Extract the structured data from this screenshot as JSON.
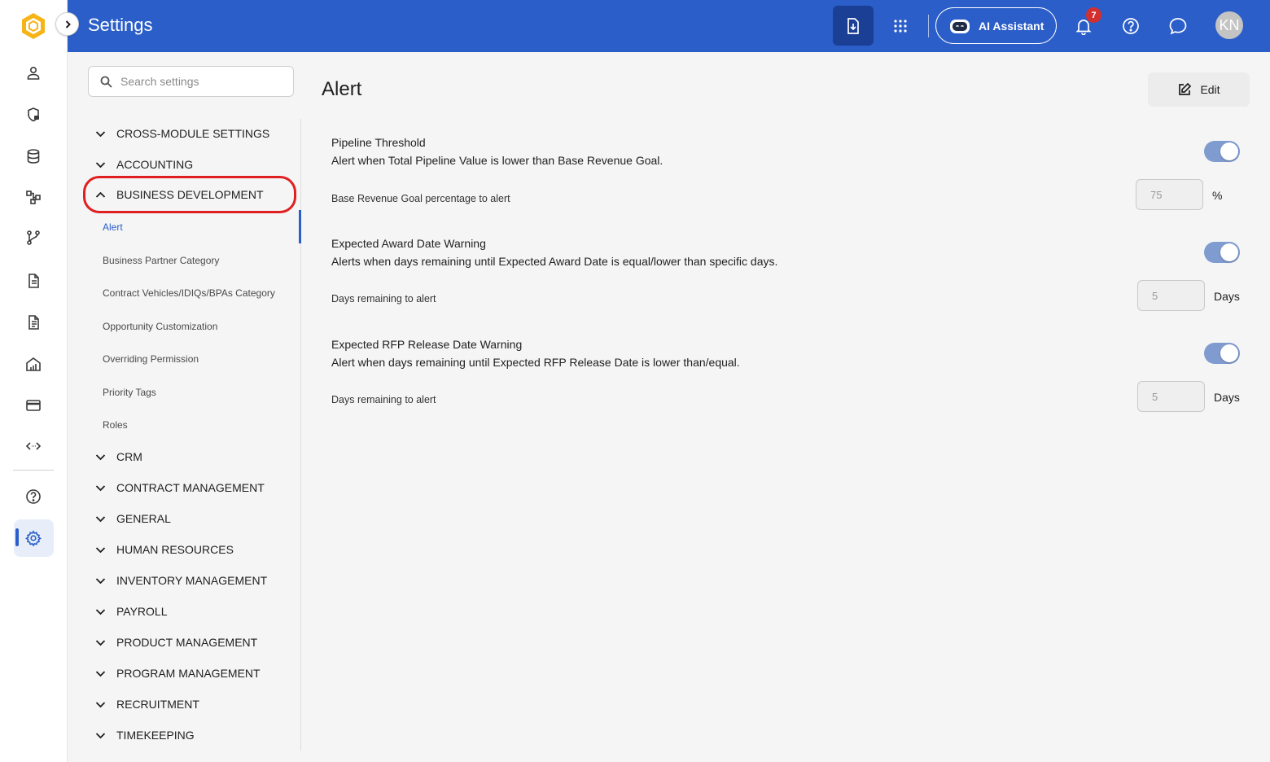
{
  "header": {
    "title": "Settings",
    "ai_assistant_label": "AI Assistant",
    "notification_count": "7",
    "avatar_initials": "KN"
  },
  "search": {
    "placeholder": "Search settings"
  },
  "nav": {
    "sections_top": [
      {
        "label": "CROSS-MODULE SETTINGS",
        "expanded": false
      },
      {
        "label": "ACCOUNTING",
        "expanded": false
      },
      {
        "label": "BUSINESS DEVELOPMENT",
        "expanded": true
      }
    ],
    "sub_items": [
      {
        "label": "Alert",
        "active": true
      },
      {
        "label": "Business Partner Category"
      },
      {
        "label": "Contract Vehicles/IDIQs/BPAs Category"
      },
      {
        "label": "Opportunity Customization"
      },
      {
        "label": "Overriding Permission"
      },
      {
        "label": "Priority Tags"
      },
      {
        "label": "Roles"
      }
    ],
    "sections_bottom": [
      {
        "label": "CRM"
      },
      {
        "label": "CONTRACT MANAGEMENT"
      },
      {
        "label": "GENERAL"
      },
      {
        "label": "HUMAN RESOURCES"
      },
      {
        "label": "INVENTORY MANAGEMENT"
      },
      {
        "label": "PAYROLL"
      },
      {
        "label": "PRODUCT MANAGEMENT"
      },
      {
        "label": "PROGRAM MANAGEMENT"
      },
      {
        "label": "RECRUITMENT"
      },
      {
        "label": "TIMEKEEPING"
      }
    ]
  },
  "content": {
    "title": "Alert",
    "edit_label": "Edit",
    "settings": [
      {
        "title": "Pipeline Threshold",
        "description": "Alert when Total Pipeline Value is lower than Base Revenue Goal.",
        "enabled": true,
        "field_label": "Base Revenue Goal percentage to alert",
        "field_value": "75",
        "unit": "%"
      },
      {
        "title": "Expected Award Date Warning",
        "description": "Alerts when days remaining until Expected Award Date is equal/lower than specific days.",
        "enabled": true,
        "field_label": "Days remaining to alert",
        "field_value": "5",
        "unit": "Days"
      },
      {
        "title": "Expected RFP Release Date Warning",
        "description": "Alert when days remaining until Expected RFP Release Date is lower than/equal.",
        "enabled": true,
        "field_label": "Days remaining to alert",
        "field_value": "5",
        "unit": "Days"
      }
    ]
  },
  "colors": {
    "brand": "#2b5ec9",
    "header_dark": "#1a3f94",
    "toggle_on": "#7f9bd0",
    "badge": "#d32f2f",
    "highlight": "#e02020"
  }
}
